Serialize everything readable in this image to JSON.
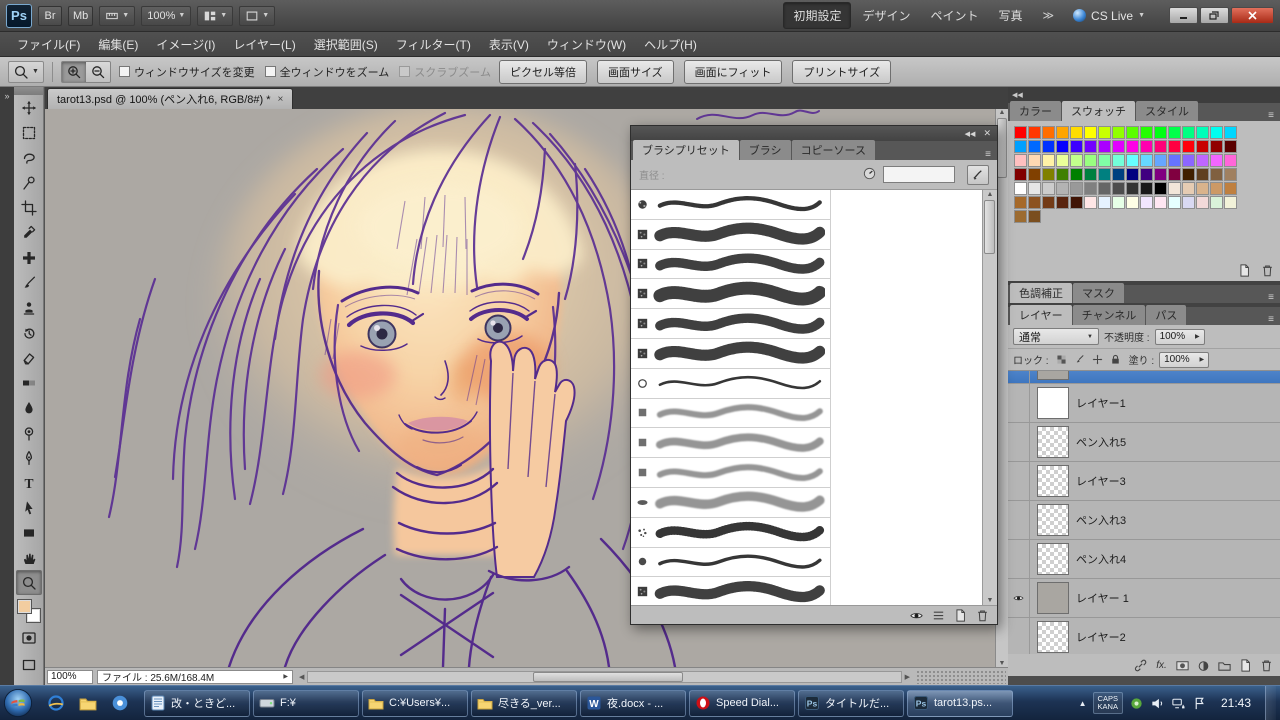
{
  "titlebar": {
    "logo": "Ps",
    "bridge": "Br",
    "minibridge": "Mb",
    "zoom": "100%",
    "workspaces": [
      "初期設定",
      "デザイン",
      "ペイント",
      "写真"
    ],
    "cs_live": "CS Live"
  },
  "menubar": {
    "items": [
      "ファイル(F)",
      "編集(E)",
      "イメージ(I)",
      "レイヤー(L)",
      "選択範囲(S)",
      "フィルター(T)",
      "表示(V)",
      "ウィンドウ(W)",
      "ヘルプ(H)"
    ]
  },
  "options": {
    "checkboxes": [
      {
        "label": "ウィンドウサイズを変更",
        "checked": false,
        "disabled": false
      },
      {
        "label": "全ウィンドウをズーム",
        "checked": false,
        "disabled": false
      },
      {
        "label": "スクラブズーム",
        "checked": false,
        "disabled": true
      }
    ],
    "buttons": [
      "ピクセル等倍",
      "画面サイズ",
      "画面にフィット",
      "プリントサイズ"
    ]
  },
  "tools": [
    "move",
    "marquee",
    "lasso",
    "quick-select",
    "crop",
    "eyedropper",
    "healing",
    "brush",
    "stamp",
    "history",
    "eraser",
    "gradient",
    "blur",
    "dodge",
    "pen",
    "type",
    "path-select",
    "shape",
    "hand",
    "zoom"
  ],
  "active_tool": "zoom",
  "fg_color": "#F2CDA0",
  "bg_color": "#FFFFFF",
  "document": {
    "tab_title": "tarot13.psd @ 100% (ペン入れ6, RGB/8#) *",
    "status_zoom": "100%",
    "status_file": "ファイル : 25.6M/168.4M"
  },
  "brush_panel": {
    "tabs": [
      "ブラシプリセット",
      "ブラシ",
      "コピーソース"
    ],
    "active_tab": "ブラシプリセット",
    "diameter_label": "直径 :",
    "diameter_value": "",
    "brushes": [
      {
        "tip": "rough",
        "size": 5
      },
      {
        "tip": "texture",
        "size": 13
      },
      {
        "tip": "texture",
        "size": 11
      },
      {
        "tip": "texture",
        "size": 15
      },
      {
        "tip": "texture",
        "size": 11
      },
      {
        "tip": "texture",
        "size": 13
      },
      {
        "tip": "ring",
        "size": 3
      },
      {
        "tip": "square",
        "size": 7
      },
      {
        "tip": "square",
        "size": 9
      },
      {
        "tip": "square",
        "size": 7
      },
      {
        "tip": "flat",
        "size": 11
      },
      {
        "tip": "spatter",
        "size": 10
      },
      {
        "tip": "round",
        "size": 4
      },
      {
        "tip": "texture",
        "size": 12
      }
    ]
  },
  "dock": {
    "color_group": {
      "tabs": [
        "カラー",
        "スウォッチ",
        "スタイル"
      ],
      "active": "スウォッチ",
      "swatches": [
        "#FF0000",
        "#FF3700",
        "#FF6E00",
        "#FFA500",
        "#FFDC00",
        "#FFFF00",
        "#C8FF00",
        "#91FF00",
        "#5AFF00",
        "#23FF00",
        "#00FF14",
        "#00FF4B",
        "#00FF82",
        "#00FFB9",
        "#00FFF0",
        "#00D7FF",
        "#00A0FF",
        "#0069FF",
        "#0032FF",
        "#0500FF",
        "#3C00FF",
        "#7300FF",
        "#AA00FF",
        "#E100FF",
        "#FF00E6",
        "#FF00AF",
        "#FF0078",
        "#FF0041",
        "#FF000A",
        "#C80000",
        "#910000",
        "#5A0000",
        "#FFC0C0",
        "#FFD9B3",
        "#FFF2A6",
        "#EAFF99",
        "#C2FF8C",
        "#99FF80",
        "#80FFA6",
        "#73FFD9",
        "#66FFFF",
        "#66D9FF",
        "#66A6FF",
        "#6673FF",
        "#8C66FF",
        "#BF66FF",
        "#F266FF",
        "#FF66D9",
        "#800000",
        "#804000",
        "#808000",
        "#408000",
        "#008000",
        "#008040",
        "#008080",
        "#004080",
        "#000080",
        "#400080",
        "#800080",
        "#800040",
        "#402000",
        "#604020",
        "#806040",
        "#A08060",
        "#FFFFFF",
        "#E6E6E6",
        "#CCCCCC",
        "#B3B3B3",
        "#999999",
        "#808080",
        "#666666",
        "#4D4D4D",
        "#333333",
        "#1A1A1A",
        "#000000",
        "#F2E6D9",
        "#E6CCB3",
        "#D9B38C",
        "#CC9966",
        "#BF8040",
        "#A66929",
        "#8C5220",
        "#733B17",
        "#59240E",
        "#401405",
        "#FFE6E6",
        "#E6F2FF",
        "#E6FFE6",
        "#FFFFE6",
        "#F2E6FF",
        "#FFE6F2",
        "#E6FFFF",
        "#D9D9F2",
        "#F2D9D9",
        "#D9F2D9",
        "#F2F2D9",
        "#9C6B30",
        "#7A4E1F"
      ]
    },
    "adjust_group": {
      "tabs": [
        "色調補正",
        "マスク"
      ],
      "active": "色調補正"
    },
    "layers_group": {
      "tabs": [
        "レイヤー",
        "チャンネル",
        "パス"
      ],
      "active": "レイヤー",
      "blend_mode": "通常",
      "opacity_label": "不透明度 :",
      "opacity": "100%",
      "lock_label": "ロック :",
      "fill_label": "塗り :",
      "fill": "100%",
      "layers": [
        {
          "name": "",
          "selected": true,
          "thumb": "solid",
          "visible": false
        },
        {
          "name": "レイヤー1",
          "selected": false,
          "thumb": "white",
          "visible": false
        },
        {
          "name": "ペン入れ5",
          "selected": false,
          "thumb": "checker",
          "visible": false
        },
        {
          "name": "レイヤー3",
          "selected": false,
          "thumb": "checker",
          "visible": false
        },
        {
          "name": "ペン入れ3",
          "selected": false,
          "thumb": "checker",
          "visible": false
        },
        {
          "name": "ペン入れ4",
          "selected": false,
          "thumb": "checker",
          "visible": false
        },
        {
          "name": "レイヤー 1",
          "selected": false,
          "thumb": "solid",
          "visible": true
        },
        {
          "name": "レイヤー2",
          "selected": false,
          "thumb": "checker",
          "visible": false
        }
      ]
    }
  },
  "taskbar": {
    "quick": [
      "ie",
      "folderwin",
      "chrome"
    ],
    "buttons": [
      {
        "icon": "doc",
        "label": "改・ときど...",
        "active": false
      },
      {
        "icon": "drive",
        "label": "F:¥",
        "active": false
      },
      {
        "icon": "folderwin",
        "label": "C:¥Users¥...",
        "active": false
      },
      {
        "icon": "folderwin",
        "label": "尽きる_ver...",
        "active": false
      },
      {
        "icon": "word",
        "label": "夜.docx - ...",
        "active": false
      },
      {
        "icon": "opera",
        "label": "Speed Dial...",
        "active": false
      },
      {
        "icon": "ps",
        "label": "タイトルだ...",
        "active": false
      },
      {
        "icon": "ps",
        "label": "tarot13.ps...",
        "active": true
      }
    ],
    "ime_caps": "CAPS",
    "ime_kana": "KANA",
    "time": "21:43"
  },
  "glyphs": {
    "arrow_down": "▼",
    "arrow_right": "▶",
    "arrow_up": "▲",
    "arrow_left": "◀",
    "close": "✕",
    "panel_menu": "≡",
    "collapse_right": "◀◀",
    "collapse_left": "»",
    "overflow": "≫",
    "tab_close": "×"
  }
}
